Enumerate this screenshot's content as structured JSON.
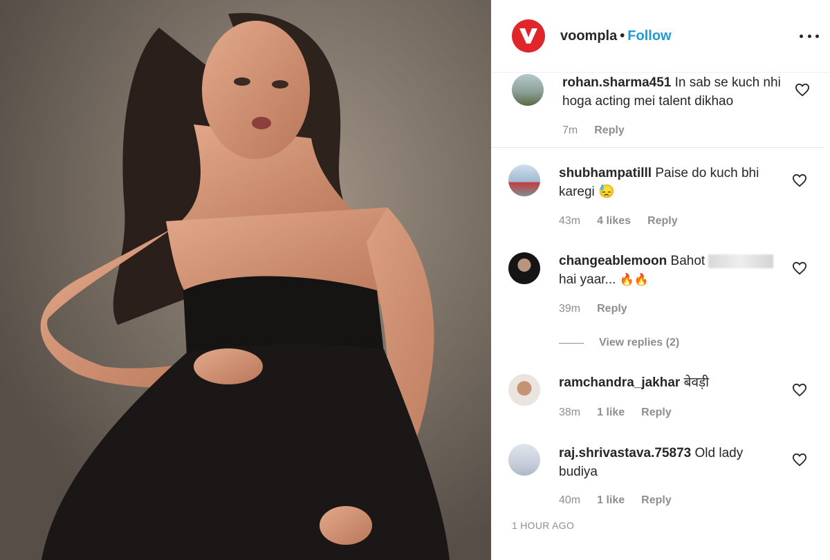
{
  "header": {
    "username": "voompla",
    "separator": "•",
    "follow_label": "Follow",
    "brand_color": "#e0252b",
    "follow_color": "#1e9ad6"
  },
  "comments": [
    {
      "username": "rohan.sharma451",
      "text": "In sab se kuch nhi hoga acting mei talent dikhao",
      "time": "7m",
      "likes": "",
      "reply_label": "Reply"
    },
    {
      "username": "shubhampatilll",
      "text": "Paise do kuch bhi karegi",
      "emoji": "😓",
      "time": "43m",
      "likes": "4 likes",
      "reply_label": "Reply"
    },
    {
      "username": "changeablemoon",
      "text_start": "Bahot",
      "text_end": "hai yaar...",
      "emoji": "🔥🔥",
      "time": "39m",
      "likes": "",
      "reply_label": "Reply",
      "view_replies_label": "View replies (2)"
    },
    {
      "username": "ramchandra_jakhar",
      "text": "बेवड़ी",
      "time": "38m",
      "likes": "1 like",
      "reply_label": "Reply"
    },
    {
      "username": "raj.shrivastava.75873",
      "text": "Old lady budiya",
      "time": "40m",
      "likes": "1 like",
      "reply_label": "Reply"
    }
  ],
  "post_timestamp": "1 HOUR AGO",
  "icons": {
    "more": "more-options-icon",
    "like": "heart-icon"
  }
}
